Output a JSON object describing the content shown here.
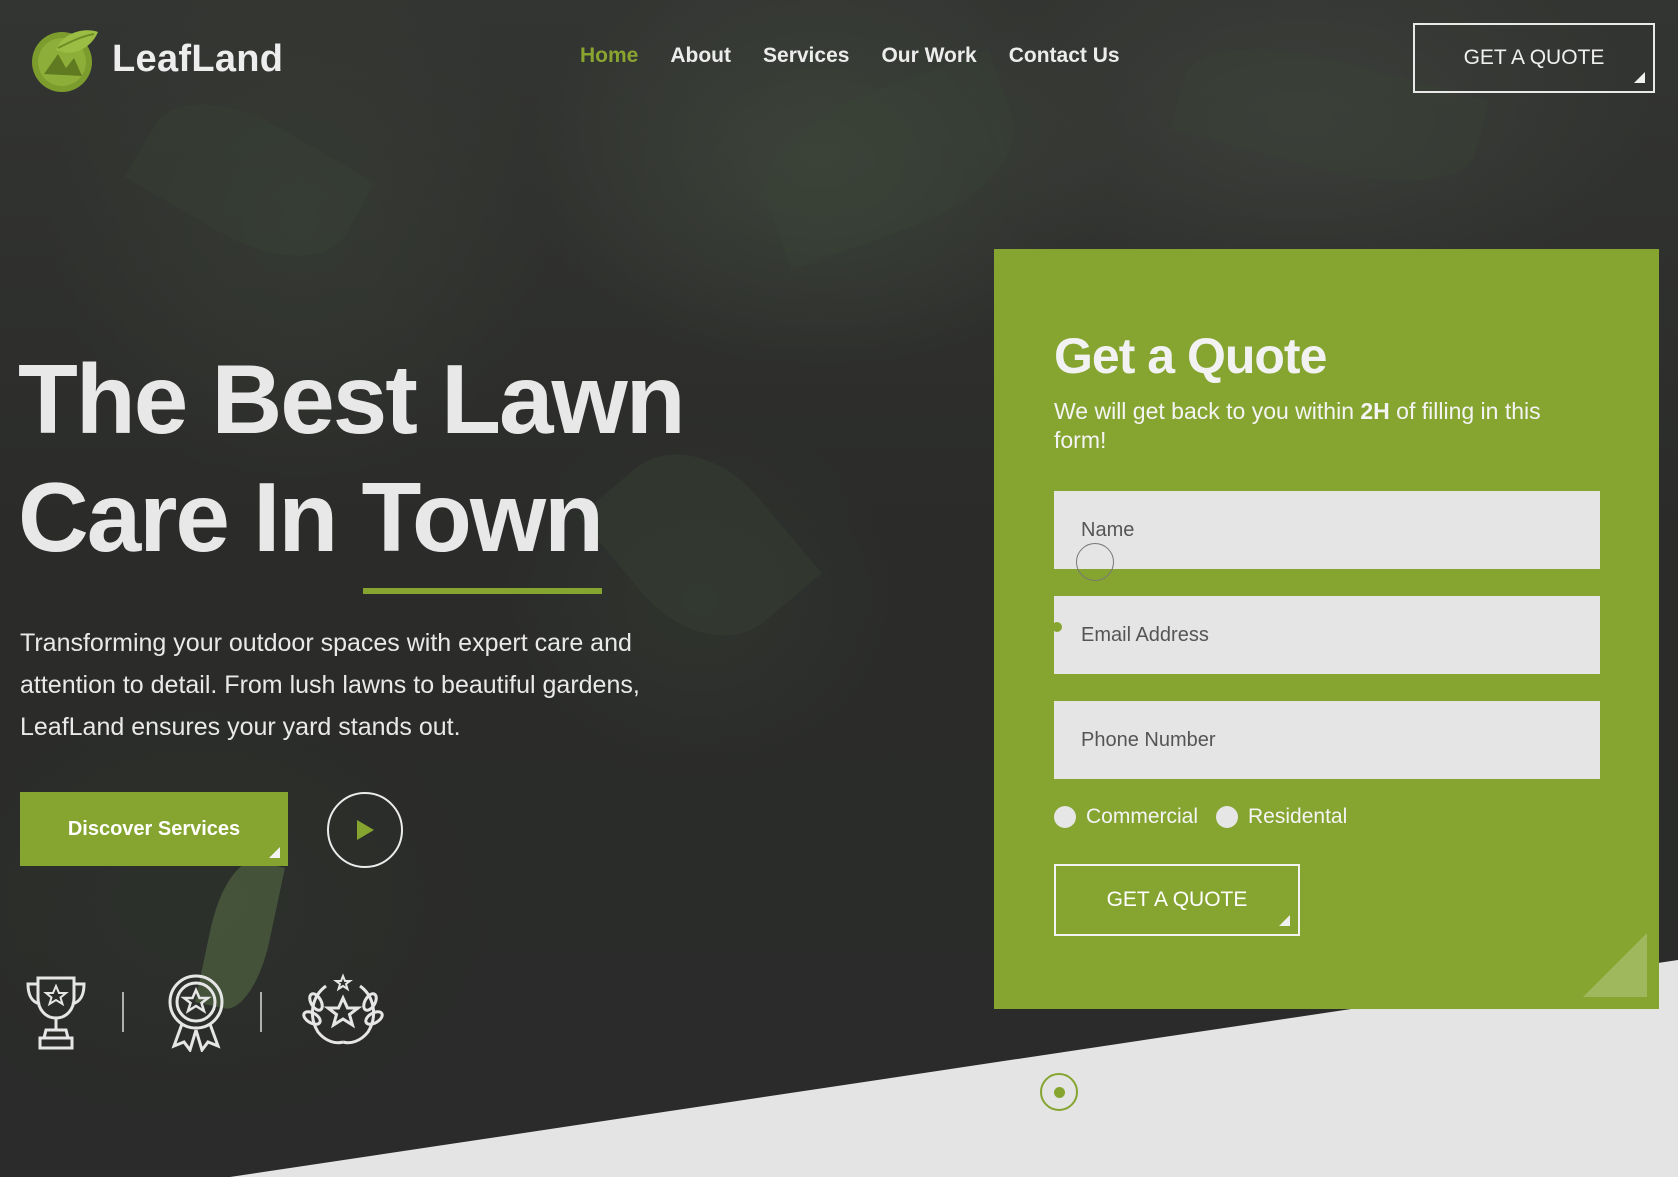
{
  "brand": {
    "name": "LeafLand",
    "accent": "#86a530",
    "dark": "#2b2c2b"
  },
  "nav": {
    "items": [
      {
        "label": "Home",
        "active": true
      },
      {
        "label": "About",
        "active": false
      },
      {
        "label": "Services",
        "active": false
      },
      {
        "label": "Our Work",
        "active": false
      },
      {
        "label": "Contact Us",
        "active": false
      }
    ],
    "cta_label": "GET A QUOTE"
  },
  "hero": {
    "title_line1": "The Best Lawn",
    "title_line2_pre": "Care In ",
    "title_line2_highlight": "Town",
    "description": "Transforming your outdoor spaces with expert care and attention to detail. From lush lawns to beautiful gardens, LeafLand ensures your yard stands out.",
    "primary_button": "Discover Services",
    "play_icon": "play-icon",
    "awards": [
      "trophy-icon",
      "medal-icon",
      "laurel-star-icon"
    ]
  },
  "quote_form": {
    "title": "Get a Quote",
    "subtitle_pre": "We will get back to you within ",
    "subtitle_bold": "2H",
    "subtitle_post": " of filling in this form!",
    "fields": {
      "name_placeholder": "Name",
      "email_placeholder": "Email Address",
      "phone_placeholder": "Phone Number"
    },
    "options": [
      "Commercial",
      "Residental"
    ],
    "submit_label": "GET A QUOTE"
  }
}
